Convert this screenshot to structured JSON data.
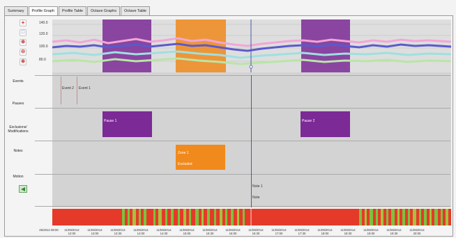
{
  "tabs": [
    {
      "label": "Summary"
    },
    {
      "label": "Profile Graph"
    },
    {
      "label": "Profile Table"
    },
    {
      "label": "Octave Graphs"
    },
    {
      "label": "Octave Table"
    }
  ],
  "active_tab": "Profile Graph",
  "toolbar": [
    "add-cursor-icon",
    "select-region-icon",
    "zoom-in-icon",
    "zoom-out-icon",
    "zoom-reset-icon"
  ],
  "rows": {
    "events": "Events",
    "pauses": "Pauses",
    "exclusions": "Exclusions/ Modifications",
    "notes": "Notes",
    "motion": "Motion"
  },
  "y_ticks": [
    "140.0",
    "120.0",
    "100.0",
    "80.0"
  ],
  "events": [
    {
      "label": "Event 2"
    },
    {
      "label": "Event 1"
    }
  ],
  "pauses": [
    {
      "label": "Pause 1"
    },
    {
      "label": "Pause 2"
    }
  ],
  "note": {
    "title": "Zone 1",
    "detail": "Excluded"
  },
  "cursor_note": {
    "title": "Note 1",
    "detail": "Note"
  },
  "x_labels": [
    "26/2014 08:00",
    "11/06/2014 12:00",
    "11/06/2014 13:00",
    "11/06/2014 13:30",
    "11/06/2014 14:00",
    "11/06/2014 14:30",
    "11/06/2014 15:00",
    "11/06/2014 15:30",
    "11/06/2014 16:00",
    "11/06/2014 16:30",
    "11/06/2014 17:00",
    "11/06/2014 17:30",
    "11/06/2014 18:00",
    "11/06/2014 18:30",
    "11/06/2014 19:00",
    "11/06/2014 19:30",
    "11/06/2014 20:00"
  ],
  "colors": {
    "pause": "#7b2a96",
    "note": "#f08a1c",
    "timeline_red": "#e53a2a",
    "timeline_green": "#7cc23d",
    "cursor": "#4a5aa8"
  }
}
